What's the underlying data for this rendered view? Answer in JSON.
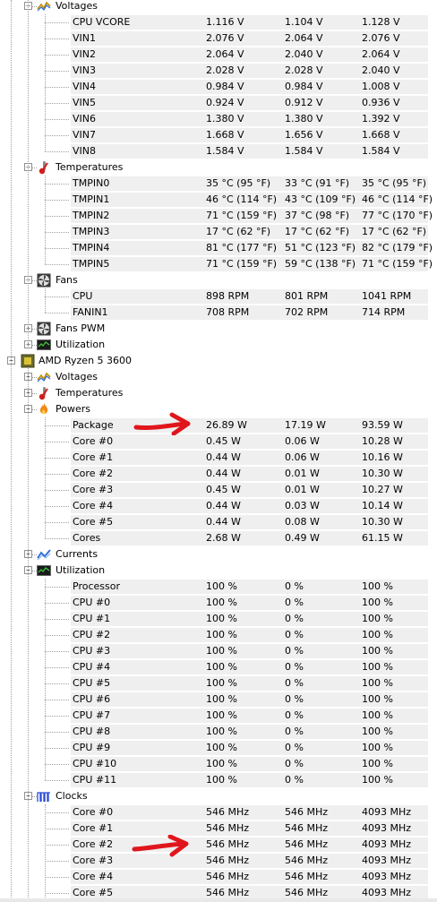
{
  "tree": [
    {
      "type": "group",
      "level": 2,
      "expanded": true,
      "icon": "voltage-icon",
      "label": "Voltages"
    },
    {
      "type": "sensor",
      "name": "CPU VCORE",
      "value": "1.116 V",
      "min": "1.104 V",
      "max": "1.128 V"
    },
    {
      "type": "sensor",
      "name": "VIN1",
      "value": "2.076 V",
      "min": "2.064 V",
      "max": "2.076 V"
    },
    {
      "type": "sensor",
      "name": "VIN2",
      "value": "2.064 V",
      "min": "2.040 V",
      "max": "2.064 V"
    },
    {
      "type": "sensor",
      "name": "VIN3",
      "value": "2.028 V",
      "min": "2.028 V",
      "max": "2.040 V"
    },
    {
      "type": "sensor",
      "name": "VIN4",
      "value": "0.984 V",
      "min": "0.984 V",
      "max": "1.008 V"
    },
    {
      "type": "sensor",
      "name": "VIN5",
      "value": "0.924 V",
      "min": "0.912 V",
      "max": "0.936 V"
    },
    {
      "type": "sensor",
      "name": "VIN6",
      "value": "1.380 V",
      "min": "1.380 V",
      "max": "1.392 V"
    },
    {
      "type": "sensor",
      "name": "VIN7",
      "value": "1.668 V",
      "min": "1.656 V",
      "max": "1.668 V"
    },
    {
      "type": "sensor",
      "name": "VIN8",
      "value": "1.584 V",
      "min": "1.584 V",
      "max": "1.584 V"
    },
    {
      "type": "group",
      "level": 2,
      "expanded": true,
      "icon": "thermometer-icon",
      "label": "Temperatures"
    },
    {
      "type": "sensor",
      "name": "TMPIN0",
      "value": "35 °C  (95 °F)",
      "min": "33 °C  (91 °F)",
      "max": "35 °C  (95 °F)"
    },
    {
      "type": "sensor",
      "name": "TMPIN1",
      "value": "46 °C  (114 °F)",
      "min": "43 °C  (109 °F)",
      "max": "46 °C  (114 °F)"
    },
    {
      "type": "sensor",
      "name": "TMPIN2",
      "value": "71 °C  (159 °F)",
      "min": "37 °C  (98 °F)",
      "max": "77 °C  (170 °F)"
    },
    {
      "type": "sensor",
      "name": "TMPIN3",
      "value": "17 °C  (62 °F)",
      "min": "17 °C  (62 °F)",
      "max": "17 °C  (62 °F)"
    },
    {
      "type": "sensor",
      "name": "TMPIN4",
      "value": "81 °C  (177 °F)",
      "min": "51 °C  (123 °F)",
      "max": "82 °C  (179 °F)"
    },
    {
      "type": "sensor",
      "name": "TMPIN5",
      "value": "71 °C  (159 °F)",
      "min": "59 °C  (138 °F)",
      "max": "71 °C  (159 °F)"
    },
    {
      "type": "group",
      "level": 2,
      "expanded": true,
      "icon": "fan-icon",
      "label": "Fans"
    },
    {
      "type": "sensor",
      "name": "CPU",
      "value": "898 RPM",
      "min": "801 RPM",
      "max": "1041 RPM"
    },
    {
      "type": "sensor",
      "name": "FANIN1",
      "value": "708 RPM",
      "min": "702 RPM",
      "max": "714 RPM"
    },
    {
      "type": "group",
      "level": 2,
      "expanded": false,
      "icon": "fan-icon",
      "label": "Fans PWM"
    },
    {
      "type": "group",
      "level": 2,
      "expanded": false,
      "icon": "utilization-icon",
      "label": "Utilization"
    },
    {
      "type": "group",
      "level": 1,
      "expanded": true,
      "icon": "cpu-chip-icon",
      "label": "AMD Ryzen 5 3600"
    },
    {
      "type": "group",
      "level": 2,
      "expanded": false,
      "icon": "voltage-icon",
      "label": "Voltages"
    },
    {
      "type": "group",
      "level": 2,
      "expanded": false,
      "icon": "thermometer-icon",
      "label": "Temperatures"
    },
    {
      "type": "group",
      "level": 2,
      "expanded": true,
      "icon": "power-flame-icon",
      "label": "Powers"
    },
    {
      "type": "sensor",
      "name": "Package",
      "value": "26.89 W",
      "min": "17.19 W",
      "max": "93.59 W"
    },
    {
      "type": "sensor",
      "name": "Core #0",
      "value": "0.45 W",
      "min": "0.06 W",
      "max": "10.28 W"
    },
    {
      "type": "sensor",
      "name": "Core #1",
      "value": "0.44 W",
      "min": "0.06 W",
      "max": "10.16 W"
    },
    {
      "type": "sensor",
      "name": "Core #2",
      "value": "0.44 W",
      "min": "0.01 W",
      "max": "10.30 W"
    },
    {
      "type": "sensor",
      "name": "Core #3",
      "value": "0.45 W",
      "min": "0.01 W",
      "max": "10.27 W"
    },
    {
      "type": "sensor",
      "name": "Core #4",
      "value": "0.44 W",
      "min": "0.03 W",
      "max": "10.14 W"
    },
    {
      "type": "sensor",
      "name": "Core #5",
      "value": "0.44 W",
      "min": "0.08 W",
      "max": "10.30 W"
    },
    {
      "type": "sensor",
      "name": "Cores",
      "value": "2.68 W",
      "min": "0.49 W",
      "max": "61.15 W"
    },
    {
      "type": "group",
      "level": 2,
      "expanded": false,
      "icon": "current-icon",
      "label": "Currents"
    },
    {
      "type": "group",
      "level": 2,
      "expanded": true,
      "icon": "utilization-icon",
      "label": "Utilization"
    },
    {
      "type": "sensor",
      "name": "Processor",
      "value": "100 %",
      "min": "0 %",
      "max": "100 %"
    },
    {
      "type": "sensor",
      "name": "CPU #0",
      "value": "100 %",
      "min": "0 %",
      "max": "100 %"
    },
    {
      "type": "sensor",
      "name": "CPU #1",
      "value": "100 %",
      "min": "0 %",
      "max": "100 %"
    },
    {
      "type": "sensor",
      "name": "CPU #2",
      "value": "100 %",
      "min": "0 %",
      "max": "100 %"
    },
    {
      "type": "sensor",
      "name": "CPU #3",
      "value": "100 %",
      "min": "0 %",
      "max": "100 %"
    },
    {
      "type": "sensor",
      "name": "CPU #4",
      "value": "100 %",
      "min": "0 %",
      "max": "100 %"
    },
    {
      "type": "sensor",
      "name": "CPU #5",
      "value": "100 %",
      "min": "0 %",
      "max": "100 %"
    },
    {
      "type": "sensor",
      "name": "CPU #6",
      "value": "100 %",
      "min": "0 %",
      "max": "100 %"
    },
    {
      "type": "sensor",
      "name": "CPU #7",
      "value": "100 %",
      "min": "0 %",
      "max": "100 %"
    },
    {
      "type": "sensor",
      "name": "CPU #8",
      "value": "100 %",
      "min": "0 %",
      "max": "100 %"
    },
    {
      "type": "sensor",
      "name": "CPU #9",
      "value": "100 %",
      "min": "0 %",
      "max": "100 %"
    },
    {
      "type": "sensor",
      "name": "CPU #10",
      "value": "100 %",
      "min": "0 %",
      "max": "100 %"
    },
    {
      "type": "sensor",
      "name": "CPU #11",
      "value": "100 %",
      "min": "0 %",
      "max": "100 %"
    },
    {
      "type": "group",
      "level": 2,
      "expanded": true,
      "icon": "clock-bars-icon",
      "label": "Clocks"
    },
    {
      "type": "sensor",
      "name": "Core #0",
      "value": "546 MHz",
      "min": "546 MHz",
      "max": "4093 MHz"
    },
    {
      "type": "sensor",
      "name": "Core #1",
      "value": "546 MHz",
      "min": "546 MHz",
      "max": "4093 MHz"
    },
    {
      "type": "sensor",
      "name": "Core #2",
      "value": "546 MHz",
      "min": "546 MHz",
      "max": "4093 MHz"
    },
    {
      "type": "sensor",
      "name": "Core #3",
      "value": "546 MHz",
      "min": "546 MHz",
      "max": "4093 MHz"
    },
    {
      "type": "sensor",
      "name": "Core #4",
      "value": "546 MHz",
      "min": "546 MHz",
      "max": "4093 MHz"
    },
    {
      "type": "sensor",
      "name": "Core #5",
      "value": "546 MHz",
      "min": "546 MHz",
      "max": "4093 MHz"
    }
  ],
  "colors": {
    "row_shade": "#efefef",
    "tree_lines": "#a0a0a0",
    "annotation_arrow": "#e0161c"
  },
  "annotations": [
    {
      "type": "arrow",
      "icon": "red-arrow-icon",
      "points_to": "Powers > Package"
    },
    {
      "type": "arrow",
      "icon": "red-arrow-icon",
      "points_to": "Clocks > Core #2"
    }
  ]
}
